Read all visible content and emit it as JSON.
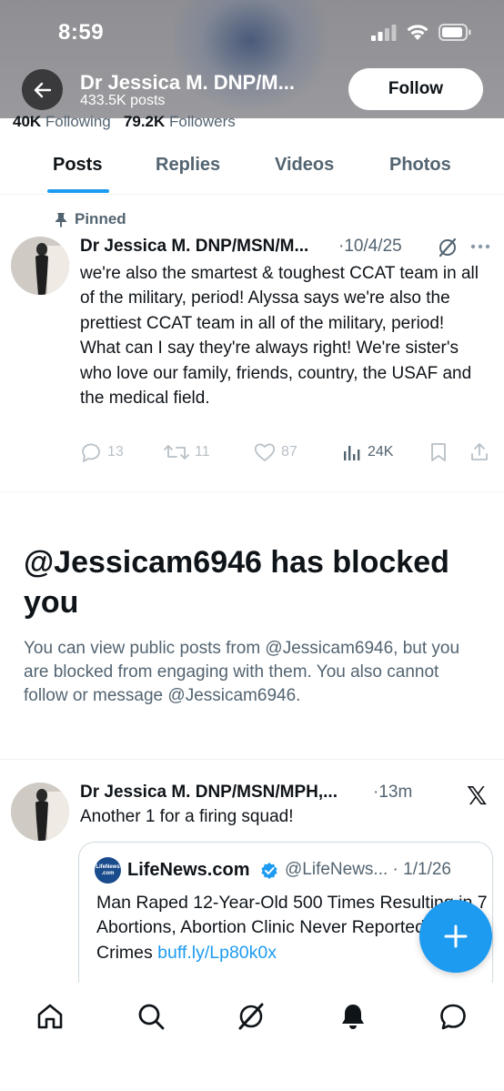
{
  "status_bar": {
    "time": "8:59"
  },
  "header": {
    "name": "Dr Jessica M. DNP/M...",
    "posts_count": "433.5K posts",
    "follow_label": "Follow"
  },
  "profile_stats": {
    "following_count": "40K",
    "following_label": "Following",
    "followers_count": "79.2K",
    "followers_label": "Followers"
  },
  "tabs": [
    {
      "label": "Posts",
      "active": true
    },
    {
      "label": "Replies",
      "active": false
    },
    {
      "label": "Videos",
      "active": false
    },
    {
      "label": "Photos",
      "active": false
    }
  ],
  "pinned_post": {
    "pinned_label": "Pinned",
    "author": "Dr Jessica M. DNP/MSN/M...",
    "date": "·10/4/25",
    "text": "we're also the smartest & toughest CCAT team in all of the military, period!  Alyssa says we're also the prettiest CCAT team in all of the military, period! What can I say they're always right!  We're sister's who love our family, friends, country, the USAF and the medical field.",
    "replies": "13",
    "reposts": "11",
    "likes": "87",
    "views": "24K"
  },
  "blocked": {
    "title": "@Jessicam6946 has blocked you",
    "description": "You can view public posts from @Jessicam6946, but you are blocked from engaging with them. You also cannot follow or message @Jessicam6946."
  },
  "post2": {
    "author": "Dr Jessica M. DNP/MSN/MPH,...",
    "time": "·13m",
    "text": "Another 1 for a firing squad!",
    "quote": {
      "logo_text": "LifeNews .com",
      "name": "LifeNews.com",
      "handle_date": "@LifeNews... · 1/1/26",
      "text": "Man Raped 12-Year-Old 500 Times Resulting in 7 Abortions, Abortion Clinic Never Reported the Crimes ",
      "link": "buff.ly/Lp80k0x"
    }
  },
  "colors": {
    "accent": "#1d9bf0",
    "secondary_text": "#536471"
  },
  "icons": [
    "back-arrow-icon",
    "pin-icon",
    "grok-icon",
    "more-icon",
    "reply-icon",
    "repost-icon",
    "like-icon",
    "views-icon",
    "bookmark-icon",
    "share-icon",
    "x-logo-icon",
    "verified-icon",
    "plus-icon",
    "home-icon",
    "search-icon",
    "notifications-icon",
    "messages-icon"
  ]
}
